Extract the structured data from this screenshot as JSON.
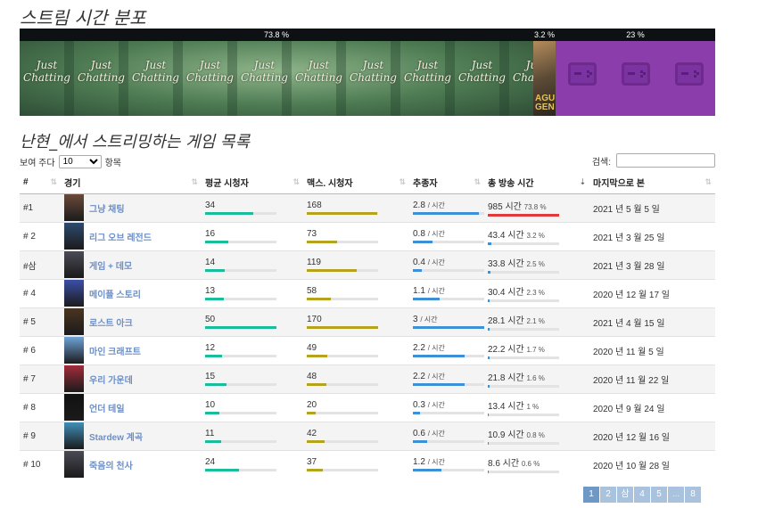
{
  "heading_distribution": "스트림 시간 분포",
  "distribution": [
    {
      "label": "73.8 %",
      "fraction": 0.738,
      "game": "Just Chatting",
      "tile_text_1": "Just",
      "tile_text_2": "Chatting"
    },
    {
      "label": "3.2 %",
      "fraction": 0.032,
      "game": "League of Legends",
      "tile_text_1": "AGU",
      "tile_text_2": "GEN"
    },
    {
      "label": "23 %",
      "fraction": 0.23,
      "game": "Games + Demos"
    }
  ],
  "heading_list": "난현_에서 스트리밍하는 게임 목록",
  "length_control": {
    "prefix": "보여 주다",
    "value": "10",
    "suffix": "항목"
  },
  "search": {
    "label": "검색:",
    "placeholder": ""
  },
  "columns": [
    "#",
    "경기",
    "평균 시청자",
    "맥스. 시청자",
    "추종자",
    "총 방송 시간",
    "마지막으로 본"
  ],
  "rows": [
    {
      "rank": "#1",
      "game": "그냥 채팅",
      "avg": "34",
      "avg_frac": 0.68,
      "max": "168",
      "max_frac": 0.99,
      "fol": "2.8",
      "fol_unit": "/ 시간",
      "fol_frac": 0.93,
      "time": "985 시간",
      "pct": "73.8 %",
      "time_frac": 1.0,
      "time_red": true,
      "last": "2021 년 5 월 5 일",
      "thumb": "#6b4a3a"
    },
    {
      "rank": "# 2",
      "game": "리그 오브 레전드",
      "avg": "16",
      "avg_frac": 0.32,
      "max": "73",
      "max_frac": 0.43,
      "fol": "0.8",
      "fol_unit": "/ 시간",
      "fol_frac": 0.27,
      "time": "43.4 시간",
      "pct": "3.2 %",
      "time_frac": 0.05,
      "time_red": false,
      "last": "2021 년 3 월 25 일",
      "thumb": "#2e4b6e"
    },
    {
      "rank": "#삼",
      "game": "게임 + 데모",
      "avg": "14",
      "avg_frac": 0.28,
      "max": "119",
      "max_frac": 0.7,
      "fol": "0.4",
      "fol_unit": "/ 시간",
      "fol_frac": 0.13,
      "time": "33.8 시간",
      "pct": "2.5 %",
      "time_frac": 0.035,
      "time_red": false,
      "last": "2021 년 3 월 28 일",
      "thumb": "#4a4a55"
    },
    {
      "rank": "# 4",
      "game": "메이플 스토리",
      "avg": "13",
      "avg_frac": 0.26,
      "max": "58",
      "max_frac": 0.34,
      "fol": "1.1",
      "fol_unit": "/ 시간",
      "fol_frac": 0.37,
      "time": "30.4 시간",
      "pct": "2.3 %",
      "time_frac": 0.03,
      "time_red": false,
      "last": "2020 년 12 월 17 일",
      "thumb": "#3b4fa8"
    },
    {
      "rank": "# 5",
      "game": "로스트 아크",
      "avg": "50",
      "avg_frac": 1.0,
      "max": "170",
      "max_frac": 1.0,
      "fol": "3",
      "fol_unit": "/ 시간",
      "fol_frac": 1.0,
      "time": "28.1 시간",
      "pct": "2.1 %",
      "time_frac": 0.028,
      "time_red": false,
      "last": "2021 년 4 월 15 일",
      "thumb": "#4a3420"
    },
    {
      "rank": "# 6",
      "game": "마인 크래프트",
      "avg": "12",
      "avg_frac": 0.24,
      "max": "49",
      "max_frac": 0.29,
      "fol": "2.2",
      "fol_unit": "/ 시간",
      "fol_frac": 0.73,
      "time": "22.2 시간",
      "pct": "1.7 %",
      "time_frac": 0.022,
      "time_red": false,
      "last": "2020 년 11 월 5 일",
      "thumb": "#6fa3d8"
    },
    {
      "rank": "# 7",
      "game": "우리 가운데",
      "avg": "15",
      "avg_frac": 0.3,
      "max": "48",
      "max_frac": 0.28,
      "fol": "2.2",
      "fol_unit": "/ 시간",
      "fol_frac": 0.73,
      "time": "21.8 시간",
      "pct": "1.6 %",
      "time_frac": 0.021,
      "time_red": false,
      "last": "2020 년 11 월 22 일",
      "thumb": "#a22c3a"
    },
    {
      "rank": "# 8",
      "game": "언더 테일",
      "avg": "10",
      "avg_frac": 0.2,
      "max": "20",
      "max_frac": 0.12,
      "fol": "0.3",
      "fol_unit": "/ 시간",
      "fol_frac": 0.1,
      "time": "13.4 시간",
      "pct": "1 %",
      "time_frac": 0.013,
      "time_red": false,
      "last": "2020 년 9 월 24 일",
      "thumb": "#111111"
    },
    {
      "rank": "# 9",
      "game": "Stardew 계곡",
      "avg": "11",
      "avg_frac": 0.22,
      "max": "42",
      "max_frac": 0.25,
      "fol": "0.6",
      "fol_unit": "/ 시간",
      "fol_frac": 0.2,
      "time": "10.9 시간",
      "pct": "0.8 %",
      "time_frac": 0.01,
      "time_red": false,
      "last": "2020 년 12 월 16 일",
      "thumb": "#3f8fb8"
    },
    {
      "rank": "# 10",
      "game": "죽음의 천사",
      "avg": "24",
      "avg_frac": 0.48,
      "max": "37",
      "max_frac": 0.22,
      "fol": "1.2",
      "fol_unit": "/ 시간",
      "fol_frac": 0.4,
      "time": "8.6 시간",
      "pct": "0.6 %",
      "time_frac": 0.008,
      "time_red": false,
      "last": "2020 년 10 월 28 일",
      "thumb": "#4a4a55"
    }
  ],
  "pagination": [
    "1",
    "2",
    "삼",
    "4",
    "5",
    "...",
    "8"
  ],
  "pagination_active": "1",
  "colors": {
    "avg_bar": "#1abc9c",
    "max_bar": "#b5a31e",
    "followers_bar": "#3d8fd6",
    "time_bar_top": "#e23a3a",
    "time_bar": "#3d8fd6",
    "link": "#6d8fc5"
  }
}
